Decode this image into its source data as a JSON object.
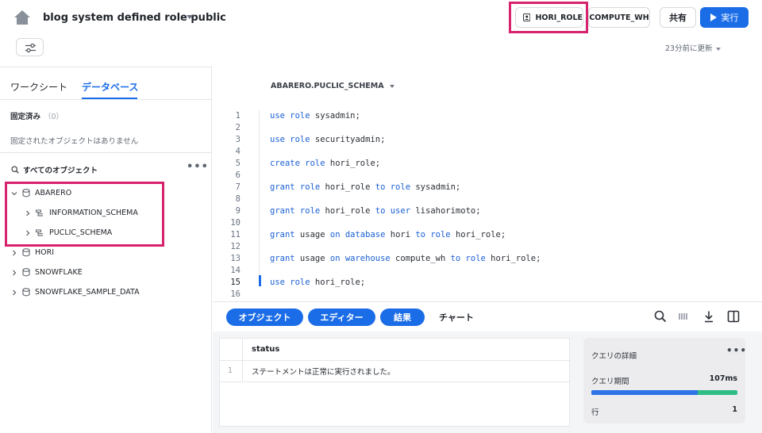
{
  "header": {
    "title": "blog system defined role public",
    "role_label": "HORI_ROLE",
    "warehouse_label": "COMPUTE_WH",
    "share_label": "共有",
    "run_label": "実行",
    "updated_text": "23分前に更新"
  },
  "sidebar": {
    "tabs": [
      {
        "label": "ワークシート"
      },
      {
        "label": "データベース"
      }
    ],
    "active_tab": "データベース",
    "pinned": {
      "label": "固定済み",
      "count": "（0）",
      "empty_text": "固定されたオブジェクトはありません"
    },
    "all_objects_label": "すべてのオブジェクト",
    "tree": [
      {
        "label": "ABARERO",
        "expanded": true
      },
      {
        "label": "INFORMATION_SCHEMA"
      },
      {
        "label": "PUCLIC_SCHEMA"
      },
      {
        "label": "HORI"
      },
      {
        "label": "SNOWFLAKE"
      },
      {
        "label": "SNOWFLAKE_SAMPLE_DATA"
      }
    ]
  },
  "editor": {
    "schema_selector": "ABARERO.PUCLIC_SCHEMA",
    "line_numbers": [
      "1",
      "2",
      "3",
      "4",
      "5",
      "6",
      "7",
      "8",
      "9",
      "10",
      "11",
      "12",
      "13",
      "14",
      "15",
      "16"
    ],
    "active_line": "15",
    "code_lines": [
      {
        "kw": "use role",
        "rest": " sysadmin;"
      },
      {
        "kw": "",
        "rest": ""
      },
      {
        "kw": "use role",
        "rest": " securityadmin;"
      },
      {
        "kw": "",
        "rest": ""
      },
      {
        "kw": "create role",
        "rest": " hori_role;"
      },
      {
        "kw": "",
        "rest": ""
      },
      {
        "kw": "grant role",
        "rest": " hori_role ",
        "kw2": "to role",
        "rest2": " sysadmin;"
      },
      {
        "kw": "",
        "rest": ""
      },
      {
        "kw": "grant role",
        "rest": " hori_role ",
        "kw2": "to user",
        "rest2": " lisahorimoto;"
      },
      {
        "kw": "",
        "rest": ""
      },
      {
        "kw": "grant",
        "rest": " usage ",
        "kw2": "on database",
        "rest2": " hori ",
        "kw3": "to role",
        "rest3": " hori_role;"
      },
      {
        "kw": "",
        "rest": ""
      },
      {
        "kw": "grant",
        "rest": " usage ",
        "kw2": "on warehouse",
        "rest2": " compute_wh ",
        "kw3": "to role",
        "rest3": " hori_role;"
      },
      {
        "kw": "",
        "rest": ""
      },
      {
        "kw": "use role",
        "rest": " hori_role;"
      },
      {
        "kw": "",
        "rest": ""
      }
    ]
  },
  "results": {
    "tabs": [
      {
        "label": "オブジェクト"
      },
      {
        "label": "エディター"
      },
      {
        "label": "結果"
      }
    ],
    "chart_label": "チャート",
    "column": "status",
    "row_number": "1",
    "cell_value": "ステートメントは正常に実行されました。"
  },
  "query_details": {
    "title": "クエリの詳細",
    "duration_label": "クエリ期間",
    "duration_value": "107ms",
    "duration_fill": 0.73,
    "rows_label": "行",
    "rows_value": "1"
  },
  "colors": {
    "accent": "#1a6ce7",
    "highlight": "#d7226e",
    "keyword": "#1a5fd6"
  }
}
